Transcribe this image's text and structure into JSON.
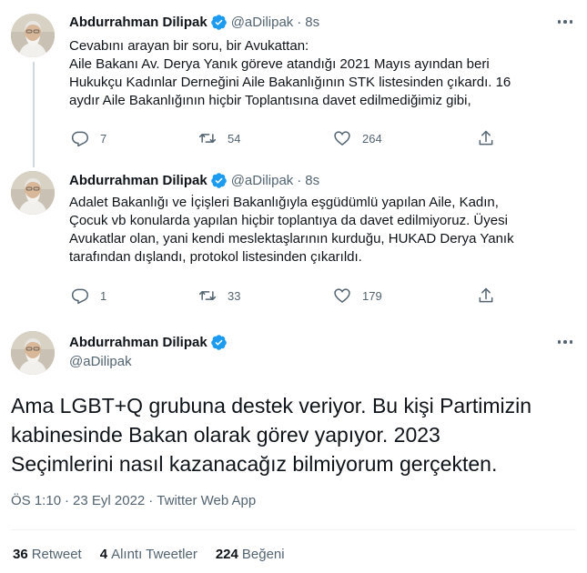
{
  "author": {
    "name": "Abdurrahman Dilipak",
    "handle": "@aDilipak",
    "verified_color": "#1d9bf0"
  },
  "tweets": [
    {
      "time": "8s",
      "lines": [
        "Cevabını arayan bir soru, bir Avukattan:",
        "Aile Bakanı Av. Derya Yanık göreve atandığı 2021 Mayıs ayından beri",
        "Hukukçu Kadınlar Derneğini Aile Bakanlığının STK listesinden çıkardı. 16",
        "aydır Aile Bakanlığının hiçbir Toplantısına davet edilmediğimiz gibi,"
      ],
      "replies": "7",
      "retweets": "54",
      "likes": "264"
    },
    {
      "time": "8s",
      "lines": [
        "Adalet Bakanlığı ve İçişleri Bakanlığıyla eşgüdümlü yapılan Aile, Kadın,",
        "Çocuk vb konularda yapılan hiçbir toplantıya da davet edilmiyoruz. Üyesi",
        "Avukatlar olan, yani kendi meslektaşlarının kurduğu, HUKAD Derya Yanık",
        "tarafından dışlandı, protokol listesinden çıkarıldı."
      ],
      "replies": "1",
      "retweets": "33",
      "likes": "179"
    }
  ],
  "main_tweet": {
    "lines": [
      "Ama LGBT+Q grubuna destek veriyor. Bu kişi Partimizin",
      "kabinesinde Bakan olarak görev yapıyor. 2023",
      "Seçimlerini nasıl kazanacağız bilmiyorum gerçekten."
    ],
    "time": "ÖS 1:10",
    "date": "23 Eyl 2022",
    "source": "Twitter Web App",
    "separator": "·",
    "retweets_count": "36",
    "retweets_label": "Retweet",
    "quotes_count": "4",
    "quotes_label": "Alıntı Tweetler",
    "likes_count": "224",
    "likes_label": "Beğeni"
  },
  "icons": {
    "reply": "reply-icon",
    "retweet": "retweet-icon",
    "like": "heart-icon",
    "share": "share-icon",
    "more": "more-icon",
    "verified": "verified-badge-icon"
  }
}
